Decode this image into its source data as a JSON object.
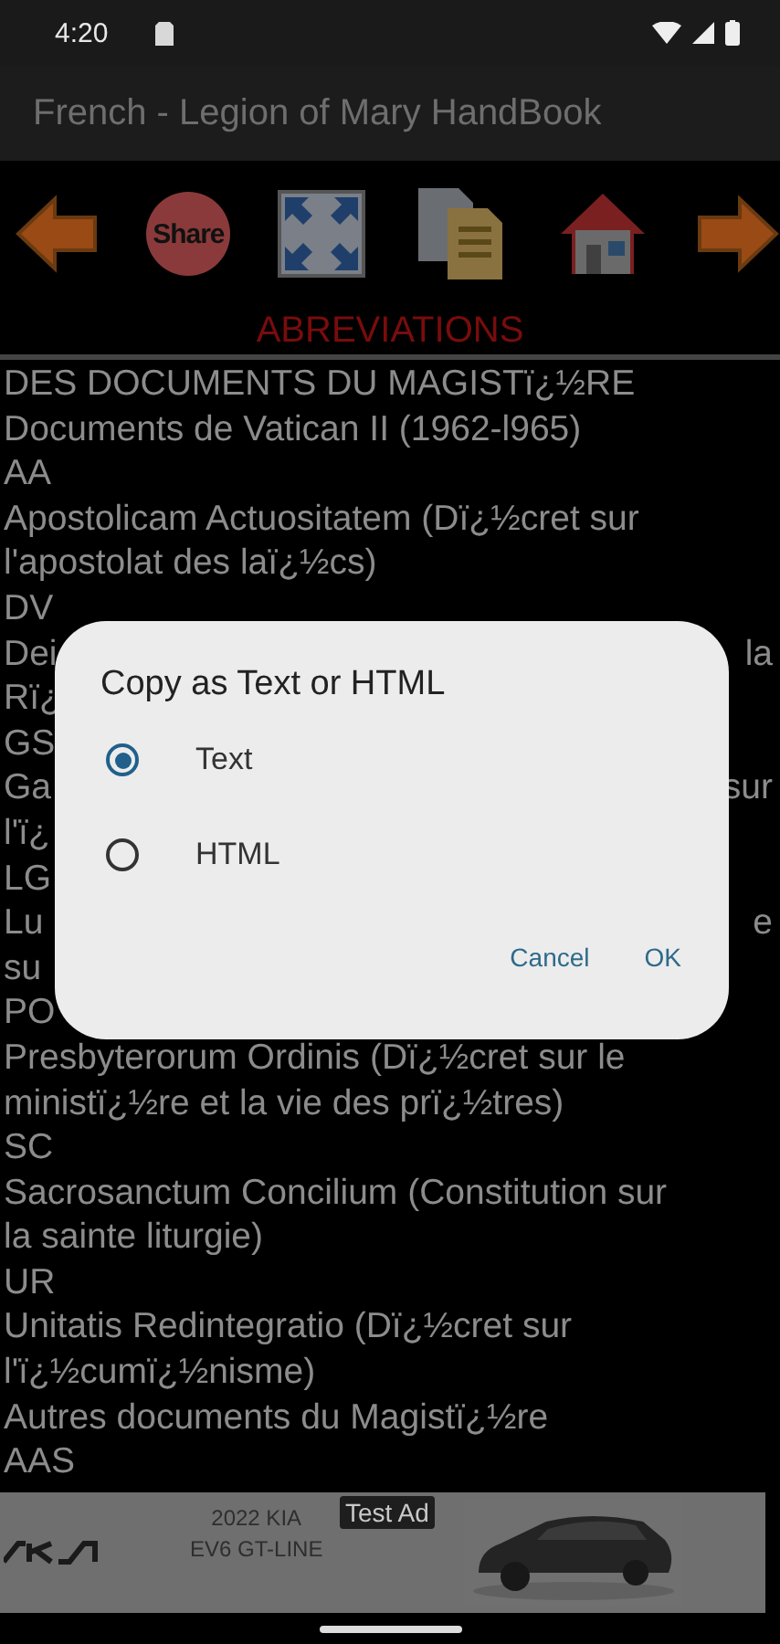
{
  "status_bar": {
    "time": "4:20"
  },
  "app_bar": {
    "title": "French - Legion of Mary HandBook"
  },
  "toolbar": {
    "share_label": "Share"
  },
  "section_title": "ABREVIATIONS",
  "lines": [
    {
      "left": "DES DOCUMENTS DU MAGISTï¿½RE"
    },
    {
      "left": "Documents de Vatican II (1962-l965)"
    },
    {
      "left": "AA"
    },
    {
      "left": "Apostolicam Actuositatem (Dï¿½cret sur"
    },
    {
      "left": "l'apostolat des laï¿½cs)"
    },
    {
      "left": "DV"
    },
    {
      "left": "Dei",
      "right": "la"
    },
    {
      "left": "Rï¿"
    },
    {
      "left": "GS"
    },
    {
      "left": "Ga",
      "right": "sur"
    },
    {
      "left": "l'ï¿"
    },
    {
      "left": "LG"
    },
    {
      "left": "Lu",
      "right": "e"
    },
    {
      "left": "su"
    },
    {
      "left": "PO"
    },
    {
      "left": "Presbyterorum Ordinis (Dï¿½cret sur le"
    },
    {
      "left": "ministï¿½re et la vie des prï¿½tres)"
    },
    {
      "left": "SC"
    },
    {
      "left": "Sacrosanctum Concilium (Constitution sur"
    },
    {
      "left": "la sainte liturgie)"
    },
    {
      "left": "UR"
    },
    {
      "left": "Unitatis Redintegratio (Dï¿½cret sur"
    },
    {
      "left": "l'ï¿½cumï¿½nisme)"
    },
    {
      "left": "Autres documents du Magistï¿½re"
    },
    {
      "left": "AAS"
    }
  ],
  "dialog": {
    "title": "Copy as Text or HTML",
    "options": [
      {
        "label": "Text",
        "selected": true
      },
      {
        "label": "HTML",
        "selected": false
      }
    ],
    "buttons": [
      "Cancel",
      "OK"
    ]
  },
  "ad": {
    "model_year": "2022 KIA",
    "model_name": "EV6 GT-LINE",
    "badge": "Test Ad"
  }
}
